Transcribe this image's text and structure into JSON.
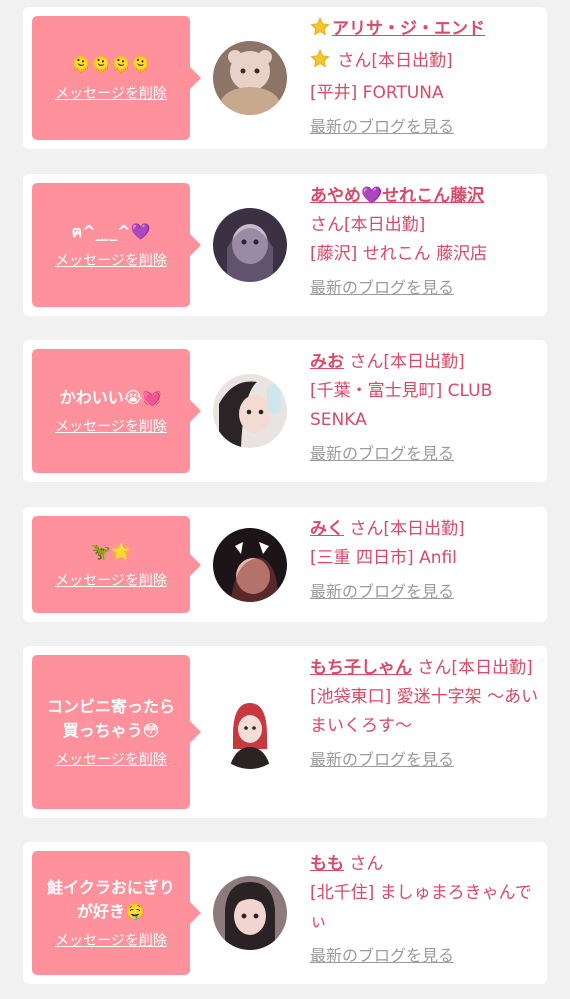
{
  "colors": {
    "background": "#f1f1f1",
    "card": "#ffffff",
    "bubble": "#fe919c",
    "name": "#d84a66",
    "blog_link": "#9b9b9b"
  },
  "cards": [
    {
      "message": "🫠🫠🫠🫠",
      "delete_label": "メッセージを削除",
      "name": "アリサ・ジ・エンド",
      "name_icon": "star-icon",
      "extra_icon": "star-icon",
      "san": "さん",
      "status": "[本日出勤]",
      "location": "[平井] FORTUNA",
      "blog_label": "最新のブログを見る",
      "avatar_palette": [
        "#8c7566",
        "#e8d2c8",
        "#c9a98e"
      ]
    },
    {
      "message": "ฅ^_ ̫_^💜",
      "delete_label": "メッセージを削除",
      "name": "あやめ💜せれこん藤沢",
      "san": "さん",
      "status": "[本日出勤]",
      "location": "[藤沢] せれこん 藤沢店",
      "blog_label": "最新のブログを見る",
      "avatar_palette": [
        "#3b3142",
        "#c7b9cc",
        "#7b6a8a"
      ]
    },
    {
      "message": "かわいい😭💓",
      "delete_label": "メッセージを削除",
      "name": "みお",
      "san": "さん",
      "status": "[本日出勤]",
      "location": "[千葉・富士見町] CLUB SENKA",
      "blog_label": "最新のブログを見る",
      "avatar_palette": [
        "#e9e3e1",
        "#2a2426",
        "#cfe7ec"
      ]
    },
    {
      "message": "🦖🌟",
      "delete_label": "メッセージを削除",
      "name": "みく",
      "san": "さん",
      "status": "[本日出勤]",
      "location": "[三重 四日市] Anfil",
      "blog_label": "最新のブログを見る",
      "avatar_palette": [
        "#1c1416",
        "#e8b7a5",
        "#8a3b3d"
      ]
    },
    {
      "message": "コンビニ寄ったら買っちゃう😳",
      "delete_label": "メッセージを削除",
      "name": "もち子しゃん",
      "san": "さん",
      "status": "[本日出勤]",
      "location": "[池袋東口] 愛迷十字架 〜あいまいくろす〜",
      "blog_label": "最新のブログを見る",
      "avatar_palette": [
        "#ffffff",
        "#c6393f",
        "#2b2224"
      ]
    },
    {
      "message": "鮭イクラおにぎりが好き🤤",
      "delete_label": "メッセージを削除",
      "name": "もも",
      "san": "さん",
      "status": "",
      "location": "[北千住] ましゅまろきゃんでぃ",
      "blog_label": "最新のブログを見る",
      "avatar_palette": [
        "#2a2224",
        "#f1d6cf",
        "#8c7a7c"
      ]
    }
  ]
}
